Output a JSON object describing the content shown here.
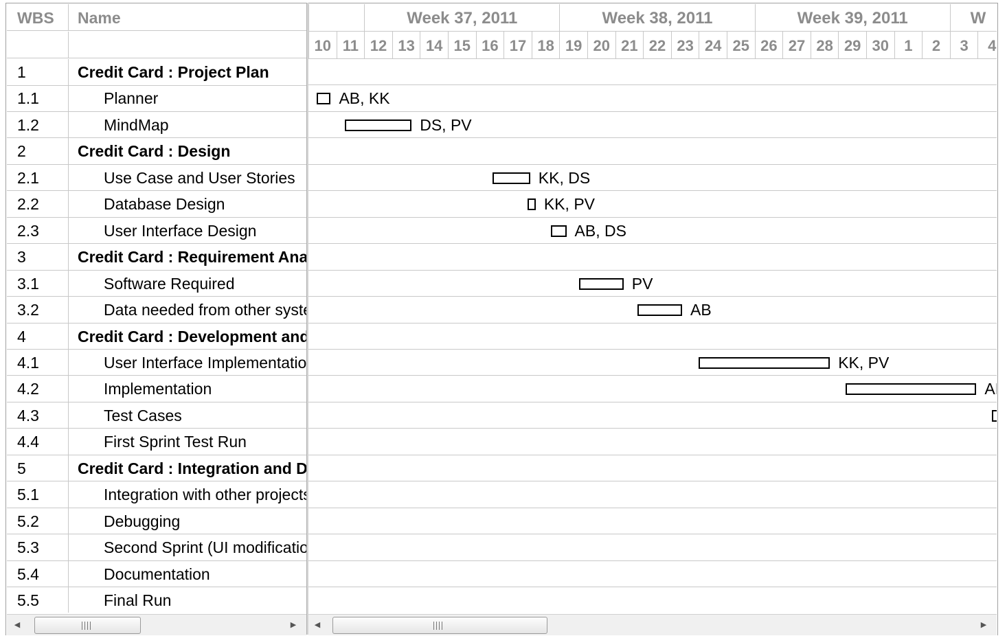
{
  "grid": {
    "headers": {
      "wbs": "WBS",
      "name": "Name"
    },
    "rows": [
      {
        "wbs": "1",
        "name": "Credit Card : Project Plan",
        "level": 0
      },
      {
        "wbs": "1.1",
        "name": "Planner",
        "level": 1
      },
      {
        "wbs": "1.2",
        "name": "MindMap",
        "level": 1
      },
      {
        "wbs": "2",
        "name": "Credit Card : Design",
        "level": 0
      },
      {
        "wbs": "2.1",
        "name": "Use Case and User Stories",
        "level": 1
      },
      {
        "wbs": "2.2",
        "name": "Database Design",
        "level": 1
      },
      {
        "wbs": "2.3",
        "name": "User Interface Design",
        "level": 1
      },
      {
        "wbs": "3",
        "name": "Credit Card : Requirement Analysis",
        "level": 0
      },
      {
        "wbs": "3.1",
        "name": "Software Required",
        "level": 1
      },
      {
        "wbs": "3.2",
        "name": "Data needed from other systems",
        "level": 1
      },
      {
        "wbs": "4",
        "name": "Credit Card : Development and Testing",
        "level": 0
      },
      {
        "wbs": "4.1",
        "name": "User Interface Implementation",
        "level": 1
      },
      {
        "wbs": "4.2",
        "name": "Implementation",
        "level": 1
      },
      {
        "wbs": "4.3",
        "name": "Test Cases",
        "level": 1
      },
      {
        "wbs": "4.4",
        "name": "First Sprint Test Run",
        "level": 1
      },
      {
        "wbs": "5",
        "name": "Credit Card : Integration and Deployment",
        "level": 0
      },
      {
        "wbs": "5.1",
        "name": "Integration with other projects",
        "level": 1
      },
      {
        "wbs": "5.2",
        "name": "Debugging",
        "level": 1
      },
      {
        "wbs": "5.3",
        "name": "Second Sprint (UI modifications)",
        "level": 1
      },
      {
        "wbs": "5.4",
        "name": "Documentation",
        "level": 1
      },
      {
        "wbs": "5.5",
        "name": "Final Run",
        "level": 1
      }
    ]
  },
  "chart": {
    "weeks": [
      {
        "label": "",
        "span": 2
      },
      {
        "label": "Week 37, 2011",
        "span": 7
      },
      {
        "label": "Week 38, 2011",
        "span": 7
      },
      {
        "label": "Week 39, 2011",
        "span": 7
      },
      {
        "label": "W",
        "span": 2
      }
    ],
    "days": [
      "10",
      "11",
      "12",
      "13",
      "14",
      "15",
      "16",
      "17",
      "18",
      "19",
      "20",
      "21",
      "22",
      "23",
      "24",
      "25",
      "26",
      "27",
      "28",
      "29",
      "30",
      "1",
      "2",
      "3",
      "4"
    ],
    "tasks": [
      {
        "row": 1,
        "start": 0.3,
        "duration": 0.5,
        "resources": "AB, KK"
      },
      {
        "row": 2,
        "start": 1.3,
        "duration": 2.4,
        "resources": "DS, PV"
      },
      {
        "row": 4,
        "start": 6.6,
        "duration": 1.35,
        "resources": "KK, DS"
      },
      {
        "row": 5,
        "start": 7.85,
        "duration": 0.3,
        "resources": "KK, PV"
      },
      {
        "row": 6,
        "start": 8.7,
        "duration": 0.55,
        "resources": "AB, DS"
      },
      {
        "row": 8,
        "start": 9.7,
        "duration": 1.6,
        "resources": "PV"
      },
      {
        "row": 9,
        "start": 11.8,
        "duration": 1.6,
        "resources": "AB"
      },
      {
        "row": 11,
        "start": 14.0,
        "duration": 4.7,
        "resources": "KK, PV"
      },
      {
        "row": 12,
        "start": 19.25,
        "duration": 4.7,
        "resources": "AB"
      },
      {
        "row": 13,
        "start": 24.5,
        "duration": 0.4,
        "resources": ""
      }
    ]
  }
}
